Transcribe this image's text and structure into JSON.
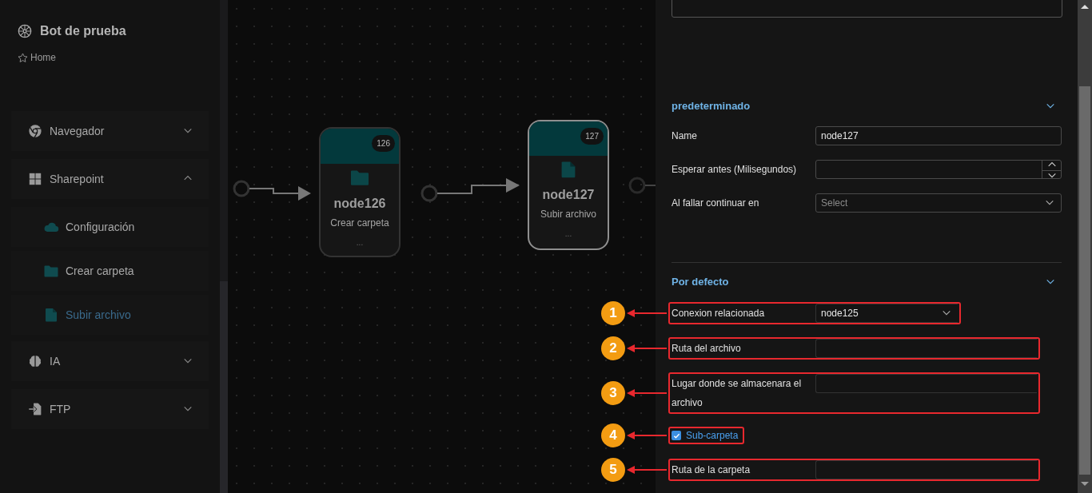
{
  "sidebar": {
    "title": "Bot de prueba",
    "breadcrumb": "Home",
    "items": [
      {
        "label": "Navegador",
        "expanded": false
      },
      {
        "label": "Sharepoint",
        "expanded": true,
        "children": [
          {
            "label": "Configuración",
            "selected": false
          },
          {
            "label": "Crear carpeta",
            "selected": false
          },
          {
            "label": "Subir archivo",
            "selected": true
          }
        ]
      },
      {
        "label": "IA",
        "expanded": false
      },
      {
        "label": "FTP",
        "expanded": false
      }
    ]
  },
  "canvas": {
    "nodes": [
      {
        "badge": "126",
        "title": "node126",
        "subtitle": "Crear carpeta",
        "more": "...",
        "selected": false
      },
      {
        "badge": "127",
        "title": "node127",
        "subtitle": "Subir archivo",
        "more": "...",
        "selected": true
      }
    ]
  },
  "panel": {
    "sections": [
      {
        "title": "predeterminado",
        "expanded": true,
        "fields": [
          {
            "kind": "text",
            "label": "Name",
            "value": "node127"
          },
          {
            "kind": "number",
            "label": "Esperar antes (Milisegundos)"
          },
          {
            "kind": "select",
            "label": "Al fallar continuar en",
            "placeholder": "Select"
          }
        ]
      },
      {
        "title": "Por defecto",
        "expanded": true,
        "fields": [
          {
            "kind": "select",
            "label": "Conexion relacionada",
            "value": "node125",
            "callout": "1"
          },
          {
            "kind": "text",
            "label": "Ruta del archivo",
            "callout": "2"
          },
          {
            "kind": "text",
            "label": "Lugar donde se almacenara el archivo",
            "callout": "3"
          },
          {
            "kind": "checkbox",
            "label": "Sub-carpeta",
            "checked": true,
            "callout": "4"
          },
          {
            "kind": "text",
            "label": "Ruta de la carpeta",
            "callout": "5"
          }
        ]
      }
    ]
  }
}
